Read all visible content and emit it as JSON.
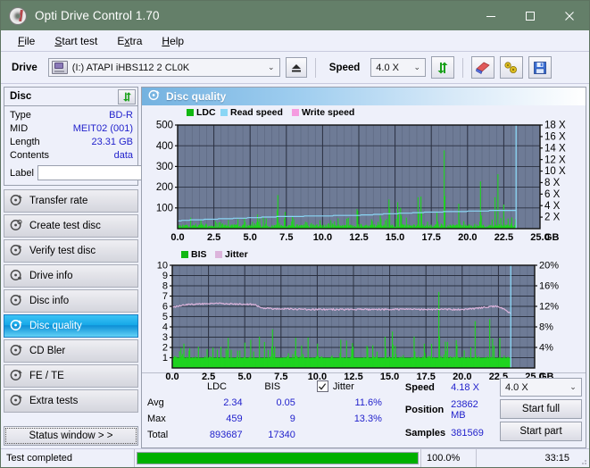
{
  "window": {
    "title": "Opti Drive Control 1.70",
    "icon": "disc-icon",
    "minimize": "–",
    "maximize": "▢",
    "close": "✕"
  },
  "menu": {
    "items": [
      {
        "label": "File",
        "accel": "F"
      },
      {
        "label": "Start test",
        "accel": "S"
      },
      {
        "label": "Extra",
        "accel": "x"
      },
      {
        "label": "Help",
        "accel": "H"
      }
    ]
  },
  "toolbar": {
    "drive_label": "Drive",
    "drive_value": "(I:)  ATAPI iHBS112  2 CL0K",
    "drive_icon": "drive-icon",
    "eject_icon": "eject-icon",
    "speed_label": "Speed",
    "speed_value": "4.0 X",
    "refresh_icon": "refresh-icon",
    "erase_icon": "eraser-icon",
    "tools_icon": "tools-icon",
    "save_icon": "floppy-save-icon"
  },
  "sidebar": {
    "disc_panel": {
      "title": "Disc",
      "refresh_icon": "refresh-icon",
      "rows": [
        {
          "key": "Type",
          "value": "BD-R"
        },
        {
          "key": "MID",
          "value": "MEIT02 (001)"
        },
        {
          "key": "Length",
          "value": "23.31 GB"
        },
        {
          "key": "Contents",
          "value": "data"
        }
      ],
      "label_key": "Label",
      "label_value": "",
      "label_placeholder": "",
      "label_button_icon": "disc-icon"
    },
    "nav": [
      {
        "label": "Transfer rate",
        "icon": "disc-test-icon",
        "selected": false
      },
      {
        "label": "Create test disc",
        "icon": "disc-test-icon",
        "selected": false
      },
      {
        "label": "Verify test disc",
        "icon": "disc-test-icon",
        "selected": false
      },
      {
        "label": "Drive info",
        "icon": "disc-test-icon",
        "selected": false
      },
      {
        "label": "Disc info",
        "icon": "disc-test-icon",
        "selected": false
      },
      {
        "label": "Disc quality",
        "icon": "disc-test-icon",
        "selected": true
      },
      {
        "label": "CD Bler",
        "icon": "disc-test-icon",
        "selected": false
      },
      {
        "label": "FE / TE",
        "icon": "disc-test-icon",
        "selected": false
      },
      {
        "label": "Extra tests",
        "icon": "disc-test-icon",
        "selected": false
      }
    ],
    "status_window_button": "Status window > >"
  },
  "main": {
    "panel_title": "Disc quality",
    "panel_icon": "disc-quality-icon"
  },
  "stats": {
    "col_headers": [
      "LDC",
      "BIS"
    ],
    "rows": [
      {
        "key": "Avg",
        "ldc": "2.34",
        "bis": "0.05",
        "jitter": "11.6%"
      },
      {
        "key": "Max",
        "ldc": "459",
        "bis": "9",
        "jitter": "13.3%"
      },
      {
        "key": "Total",
        "ldc": "893687",
        "bis": "17340",
        "jitter": ""
      }
    ],
    "jitter_label": "Jitter",
    "jitter_checked": true,
    "speed_label": "Speed",
    "speed_value": "4.18 X",
    "position_label": "Position",
    "position_value": "23862 MB",
    "samples_label": "Samples",
    "samples_value": "381569",
    "speed_select": "4.0 X",
    "start_full_button": "Start full",
    "start_part_button": "Start part"
  },
  "statusbar": {
    "message": "Test completed",
    "progress_percent": "100.0%",
    "progress_value": 100,
    "elapsed": "33:15"
  },
  "colors": {
    "titlebar": "#647f69",
    "accent_blue": "#16a8e8",
    "plot_bg": "#6e7b96",
    "ldc_green": "#1ed41e",
    "read_speed": "#8ad6f5",
    "write_speed": "#f59ce0",
    "jitter_pink": "#dcb4dc",
    "value_blue": "#2222cc",
    "progress_green": "#00b000"
  },
  "chart_data": [
    {
      "type": "line",
      "name": "disc-quality-ldc-chart",
      "title": "",
      "xlabel": "GB",
      "ylabel": "LDC",
      "xlim": [
        0,
        25
      ],
      "ylim": [
        0,
        500
      ],
      "y2lim": [
        0,
        18
      ],
      "y2label": "X",
      "xticks": [
        "0.0",
        "2.5",
        "5.0",
        "7.5",
        "10.0",
        "12.5",
        "15.0",
        "17.5",
        "20.0",
        "22.5",
        "25.0"
      ],
      "yticks": [
        100,
        200,
        300,
        400,
        500
      ],
      "y2ticks": [
        2,
        4,
        6,
        8,
        10,
        12,
        14,
        16,
        18
      ],
      "grid": true,
      "legend": [
        {
          "label": "LDC",
          "color": "#12b812"
        },
        {
          "label": "Read speed",
          "color": "#8ad6f5"
        },
        {
          "label": "Write speed",
          "color": "#f59ce0"
        }
      ],
      "series": [
        {
          "name": "Read speed",
          "color": "#8ad6f5",
          "unit": "X",
          "x": [
            0.0,
            0.6,
            1.3,
            2.1,
            2.9,
            3.7,
            4.5,
            5.3,
            6.1,
            6.9,
            7.7,
            8.5,
            9.3,
            10.1,
            10.9,
            11.7,
            12.5,
            13.3,
            14.1,
            14.9,
            15.7,
            16.5,
            17.3,
            18.1,
            18.9,
            19.7,
            20.5,
            21.3,
            22.1,
            22.9,
            23.3
          ],
          "values": [
            1.75,
            1.9,
            2.0,
            2.1,
            2.2,
            2.3,
            2.4,
            2.5,
            2.6,
            2.7,
            2.75,
            2.8,
            2.85,
            2.9,
            2.95,
            3.0,
            3.05,
            3.15,
            3.3,
            3.4,
            3.5,
            3.6,
            3.75,
            3.8,
            3.85,
            3.9,
            4.0,
            4.05,
            4.1,
            4.12,
            4.15
          ]
        },
        {
          "name": "LDC",
          "color": "#12b812",
          "unit": "errors",
          "description": "Dense green error spikes across 0-23.3 GB, baseline near 10-30, notable peaks",
          "peaks": [
            {
              "x": 0.9,
              "y": 55
            },
            {
              "x": 1.6,
              "y": 45
            },
            {
              "x": 2.6,
              "y": 40
            },
            {
              "x": 3.5,
              "y": 48
            },
            {
              "x": 4.6,
              "y": 60
            },
            {
              "x": 5.5,
              "y": 85
            },
            {
              "x": 6.1,
              "y": 62
            },
            {
              "x": 6.9,
              "y": 215
            },
            {
              "x": 7.4,
              "y": 110
            },
            {
              "x": 7.9,
              "y": 78
            },
            {
              "x": 9.2,
              "y": 40
            },
            {
              "x": 10.4,
              "y": 42
            },
            {
              "x": 12.4,
              "y": 155
            },
            {
              "x": 13.4,
              "y": 70
            },
            {
              "x": 14.0,
              "y": 95
            },
            {
              "x": 14.6,
              "y": 205
            },
            {
              "x": 15.2,
              "y": 180
            },
            {
              "x": 15.4,
              "y": 140
            },
            {
              "x": 16.6,
              "y": 200
            },
            {
              "x": 16.8,
              "y": 202
            },
            {
              "x": 17.9,
              "y": 95
            },
            {
              "x": 18.4,
              "y": 459
            },
            {
              "x": 19.4,
              "y": 140
            },
            {
              "x": 20.9,
              "y": 250
            },
            {
              "x": 21.9,
              "y": 160
            },
            {
              "x": 22.1,
              "y": 275
            },
            {
              "x": 22.5,
              "y": 120
            }
          ]
        }
      ]
    },
    {
      "type": "line",
      "name": "disc-quality-bis-jitter-chart",
      "title": "",
      "xlabel": "GB",
      "ylabel": "BIS",
      "xlim": [
        0,
        25
      ],
      "ylim": [
        0,
        10
      ],
      "y2lim": [
        0,
        20
      ],
      "y2label": "%",
      "xticks": [
        "0.0",
        "2.5",
        "5.0",
        "7.5",
        "10.0",
        "12.5",
        "15.0",
        "17.5",
        "20.0",
        "22.5",
        "25.0"
      ],
      "yticks": [
        1,
        2,
        3,
        4,
        5,
        6,
        7,
        8,
        9,
        10
      ],
      "y2ticks": [
        "4%",
        "8%",
        "12%",
        "16%",
        "20%"
      ],
      "grid": true,
      "legend": [
        {
          "label": "BIS",
          "color": "#12b812"
        },
        {
          "label": "Jitter",
          "color": "#dcb4dc"
        }
      ],
      "series": [
        {
          "name": "Jitter",
          "color": "#dcb4dc",
          "unit": "%",
          "x": [
            0.0,
            0.8,
            1.6,
            2.4,
            3.2,
            4.0,
            4.8,
            5.6,
            6.2,
            7.0,
            8.0,
            9.0,
            10.0,
            11.0,
            12.0,
            13.0,
            14.0,
            15.0,
            16.0,
            17.0,
            18.0,
            19.0,
            20.0,
            21.0,
            21.8,
            22.4,
            23.0,
            23.3
          ],
          "values": [
            11.8,
            12.3,
            12.4,
            12.5,
            12.6,
            12.5,
            12.4,
            12.4,
            11.7,
            11.5,
            11.5,
            11.4,
            11.4,
            11.4,
            11.4,
            11.4,
            11.4,
            11.4,
            11.4,
            11.4,
            11.4,
            11.4,
            11.4,
            11.6,
            11.9,
            12.0,
            11.3,
            10.6
          ]
        },
        {
          "name": "BIS",
          "color": "#12b812",
          "unit": "errors",
          "description": "Dense green bars, solid fill to 1, frequent spikes to 2-3, several to 4-5",
          "peaks": [
            {
              "x": 0.6,
              "y": 2
            },
            {
              "x": 1.2,
              "y": 2
            },
            {
              "x": 1.8,
              "y": 2.2
            },
            {
              "x": 2.4,
              "y": 2
            },
            {
              "x": 3.1,
              "y": 2
            },
            {
              "x": 3.8,
              "y": 2
            },
            {
              "x": 4.5,
              "y": 2
            },
            {
              "x": 5.0,
              "y": 3
            },
            {
              "x": 5.6,
              "y": 2
            },
            {
              "x": 6.9,
              "y": 5
            },
            {
              "x": 8.0,
              "y": 2
            },
            {
              "x": 9.0,
              "y": 2
            },
            {
              "x": 10.0,
              "y": 2
            },
            {
              "x": 11.0,
              "y": 2
            },
            {
              "x": 12.4,
              "y": 3
            },
            {
              "x": 13.5,
              "y": 2
            },
            {
              "x": 14.7,
              "y": 4
            },
            {
              "x": 15.2,
              "y": 5
            },
            {
              "x": 15.4,
              "y": 3
            },
            {
              "x": 16.7,
              "y": 4
            },
            {
              "x": 17.4,
              "y": 3
            },
            {
              "x": 18.4,
              "y": 9
            },
            {
              "x": 19.0,
              "y": 3
            },
            {
              "x": 20.9,
              "y": 5
            },
            {
              "x": 21.9,
              "y": 5
            },
            {
              "x": 22.1,
              "y": 3
            },
            {
              "x": 22.6,
              "y": 3
            }
          ]
        }
      ]
    }
  ]
}
